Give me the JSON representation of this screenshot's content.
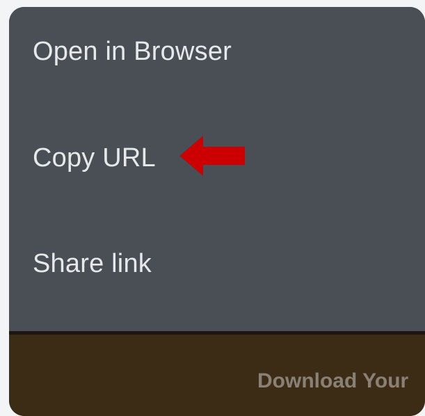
{
  "menu": {
    "items": [
      {
        "label": "Open in Browser"
      },
      {
        "label": "Copy URL"
      },
      {
        "label": "Share link"
      }
    ],
    "highlight_arrow_color": "#cc0000"
  },
  "banner": {
    "text": "Download Your"
  },
  "colors": {
    "menu_background": "#4a4f56",
    "menu_text": "#e6e8ea",
    "banner_background": "#3c2c15",
    "page_background": "#f3f4f6"
  }
}
